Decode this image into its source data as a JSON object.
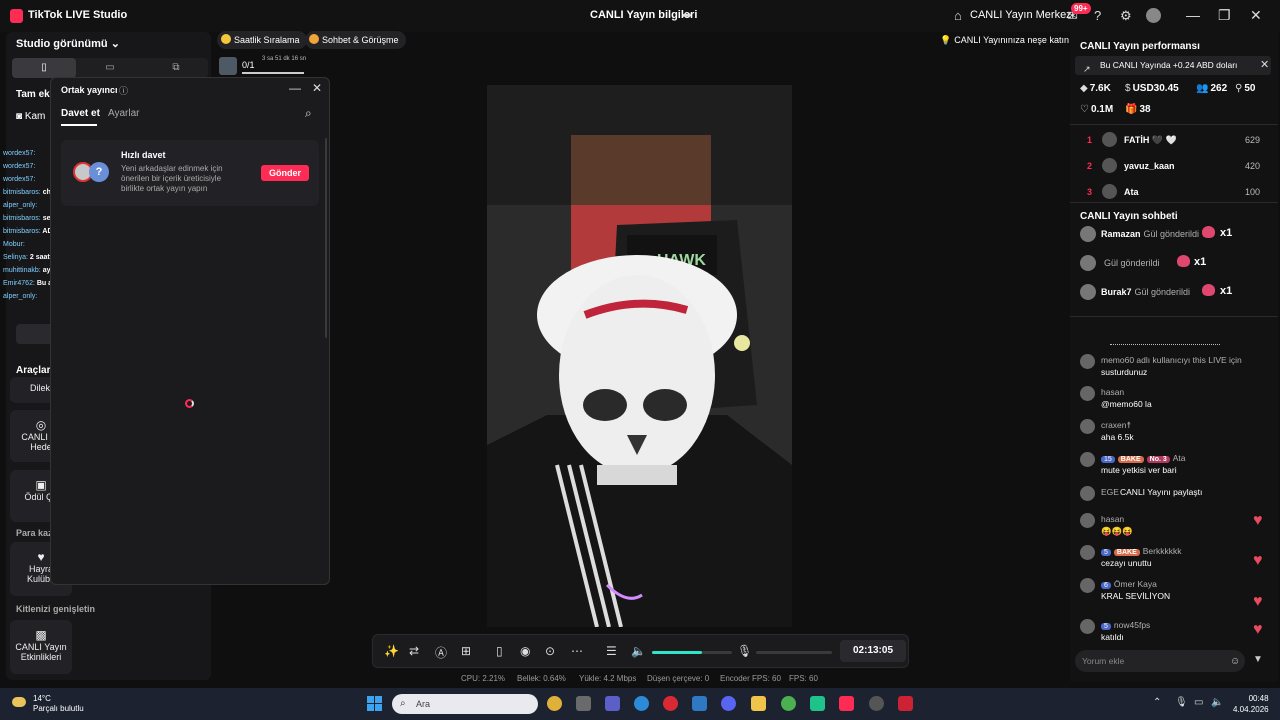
{
  "titlebar": {
    "app_name": "TikTok LIVE Studio",
    "center_title": "CANLI Yayın bilgileri",
    "live_center": "CANLI Yayın Merkezi",
    "notif_badge": "99+"
  },
  "left": {
    "studio_view": "Studio görünümü",
    "partial_tam": "Tam ekr",
    "partial_kam": "Kam",
    "tools": "Araçlar",
    "tool_1": "Dilekl",
    "tool_2a": "CANLI Ya",
    "tool_2b": "Hede",
    "tool_3": "Ödül Ça",
    "earn": "Para kaz",
    "tool_4a": "Hayra",
    "tool_4b": "Kulübü",
    "expand": "Kitlenizi genişletin",
    "tool_5a": "CANLI Yayın",
    "tool_5b": "Etkinlikleri"
  },
  "chips": {
    "hourly": "Saatlik Sıralama",
    "chat": "Sohbet & Görüşme",
    "hint": "CANLI Yayınınıza neşe katın"
  },
  "progress": {
    "value": "0/1",
    "time": "3 sa 51 dk 16 sn",
    "fill_fraction": 1.0
  },
  "chat_overlay": [
    {
      "user": "wordex57:",
      "text": ""
    },
    {
      "user": "wordex57:",
      "text": ""
    },
    {
      "user": "wordex57:",
      "text": ""
    },
    {
      "user": "bitmisbaros:",
      "text": "chate bakın"
    },
    {
      "user": "alper_only:",
      "text": ""
    },
    {
      "user": "bitmisbaros:",
      "text": "seri"
    },
    {
      "user": "bitmisbaros:",
      "text": "ADSGMAGSMÖADGSÖADGSADGA"
    },
    {
      "user": "Mobur:",
      "text": ""
    },
    {
      "user": "Selinya:",
      "text": "2 saattir bu kızlayız ne zaman çıkcaz"
    },
    {
      "user": "muhittinakb:",
      "text": "ayıp ettin bu arada oyunu siliyorum"
    },
    {
      "user": "Emir4762:",
      "text": "Bu adam çok komik bir adam ya at organı"
    },
    {
      "user": "alper_only:",
      "text": ""
    }
  ],
  "cohost": {
    "title": "Ortak yayıncı",
    "tab_invite": "Davet et",
    "tab_settings": "Ayarlar",
    "quick_title": "Hızlı davet",
    "quick_desc": "Yeni arkadaşlar edinmek için önerilen bir içerik üreticisiyle birlikte ortak yayın yapın",
    "send": "Gönder"
  },
  "toolbar": {
    "timer": "02:13:05",
    "volume": 0.62
  },
  "stats": {
    "cpu": "CPU: 2.21%",
    "memory": "Bellek: 0.64%",
    "upload": "Yükle: 4.2 Mbps",
    "dropped": "Düşen çerçeve: 0",
    "encoder_fps": "Encoder FPS: 60",
    "fps": "FPS: 60"
  },
  "right": {
    "perf_title": "CANLI Yayın performansı",
    "banner": "Bu CANLI Yayında +0.24 ABD doları",
    "stat_coins": "7.6K",
    "stat_usd": "USD30.45",
    "stat_viewers": "262",
    "stat_new": "50",
    "stat_likes": "0.1M",
    "stat_gifts": "38",
    "ranking": [
      {
        "rank": "1",
        "name": "FATİH 🖤 🤍",
        "score": "629"
      },
      {
        "rank": "2",
        "name": "yavuz_kaan",
        "score": "420"
      },
      {
        "rank": "3",
        "name": "Ata",
        "score": "100"
      }
    ],
    "chat_title": "CANLI Yayın sohbeti",
    "gifts": [
      {
        "name": "Ramazan",
        "action": "Gül gönderildi",
        "count": "x1"
      },
      {
        "name": "",
        "action": "Gül gönderildi",
        "count": "x1"
      },
      {
        "name": "Burak7",
        "action": "Gül gönderildi",
        "count": "x1"
      }
    ],
    "messages": [
      {
        "name": "",
        "text": ""
      },
      {
        "name": "memo60 adlı kullanıcıyı this LIVE için",
        "text": "susturdunuz"
      },
      {
        "name": "hasan",
        "text": "@memo60 la"
      },
      {
        "name": "craxen☨",
        "text": "aha 6.5k"
      },
      {
        "name": "Ata",
        "badges": [
          "15",
          "BAKE",
          "No. 3"
        ],
        "text": "mute yetkisi ver bari"
      },
      {
        "name": "EGE",
        "text": "CANLI Yayını paylaştı"
      },
      {
        "name": "hasan",
        "text": "😝😝😝"
      },
      {
        "name": "Berkkkkkk",
        "badges": [
          "5",
          "BAKE"
        ],
        "text": "cezayı unuttu"
      },
      {
        "name": "Ömer Kaya",
        "badges": [
          "6"
        ],
        "text": "KRAL SEVİLİYON"
      },
      {
        "name": "now45fps",
        "badges": [
          "5"
        ],
        "text": "katıldı"
      }
    ],
    "comment_placeholder": "Yorum ekle"
  },
  "taskbar": {
    "temp": "14°C",
    "weather": "Parçalı bulutlu",
    "search": "Ara",
    "time": "00:48",
    "date": "4.04.2026"
  }
}
